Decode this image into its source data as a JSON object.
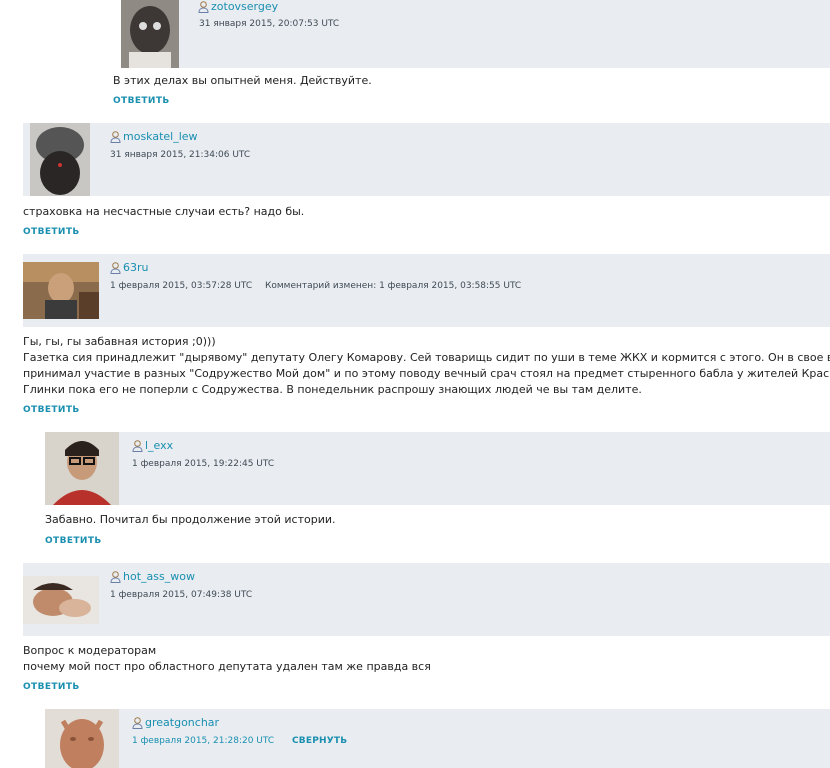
{
  "comments": [
    {
      "user": "zotovsergey",
      "date": "31 января 2015, 20:07:53 UTC",
      "lines": [
        "В этих делах вы опытней меня. Действуйте."
      ],
      "reply": "ОТВЕТИТЬ"
    },
    {
      "user": "moskatel_lew",
      "date": "31 января 2015, 21:34:06 UTC",
      "lines": [
        "страховка на несчастные случаи есть? надо бы."
      ],
      "reply": "ОТВЕТИТЬ"
    },
    {
      "user": "63ru",
      "date": "1 февраля 2015, 03:57:28 UTC",
      "edited": "Комментарий изменен:  1 февраля 2015, 03:58:55 UTC",
      "lines": [
        "Гы, гы, гы забавная история ;0)))",
        "Газетка сия принадлежит \"дырявому\" депутату Олегу Комарову. Сей товарищь сидит по уши в теме ЖКХ и кормится с этого. Он в свое время",
        "принимал участие в разных \"Содружество Мой дом\" и по этому поводу вечный срач стоял на предмет стыренного бабла у жителей Красной",
        "Глинки пока его не поперли с Содружества. В понедельник распрошу знающих людей че вы там делите."
      ],
      "reply": "ОТВЕТИТЬ"
    },
    {
      "user": "l_exx",
      "date": "1 февраля 2015, 19:22:45 UTC",
      "lines": [
        "Забавно. Почитал бы продолжение этой истории."
      ],
      "reply": "ОТВЕТИТЬ"
    },
    {
      "user": "hot_ass_wow",
      "date": "1 февраля 2015, 07:49:38 UTC",
      "lines": [
        "Вопрос к модераторам",
        "почему мой пост про областного депутата удален там же правда вся"
      ],
      "reply": "ОТВЕТИТЬ"
    },
    {
      "user": "greatgonchar",
      "date": "1 февраля 2015, 21:28:20 UTC",
      "collapse": "СВЕРНУТЬ",
      "lines": []
    }
  ],
  "colors": {
    "link": "#1a8fb0",
    "header_bg": "#e9edf1",
    "text": "#222222"
  },
  "icons": {
    "user": "user-icon"
  }
}
